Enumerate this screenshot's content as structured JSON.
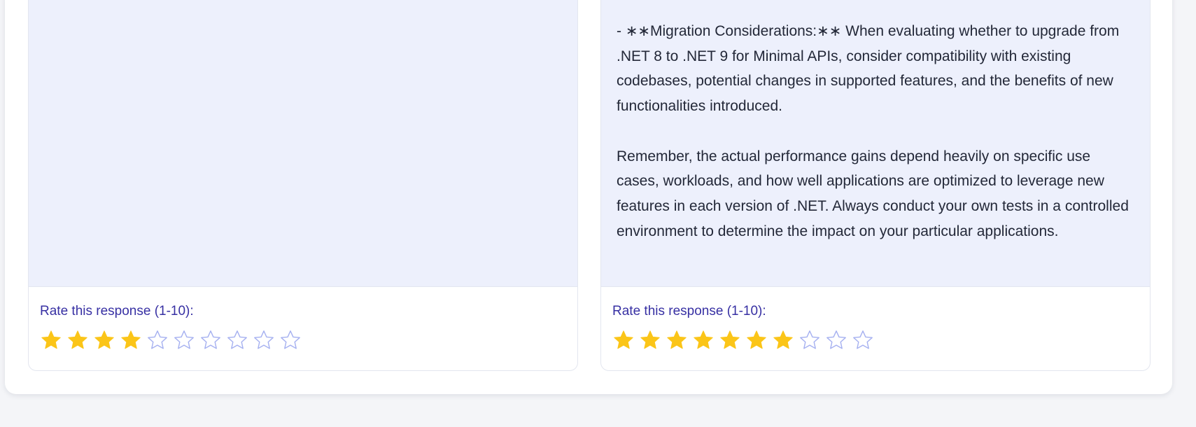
{
  "left_panel": {
    "rating_label": "Rate this response (1-10):",
    "rating": 4,
    "max_rating": 10
  },
  "right_panel": {
    "paragraphs": [
      "- ∗∗Migration Considerations:∗∗ When evaluating whether to upgrade from .NET 8 to .NET 9 for Minimal APIs, consider compatibility with existing codebases, potential changes in supported features, and the benefits of new functionalities introduced.",
      "Remember, the actual performance gains depend heavily on specific use cases, workloads, and how well applications are optimized to leverage new features in each version of .NET. Always conduct your own tests in a controlled environment to determine the impact on your particular applications."
    ],
    "rating_label": "Rate this response (1-10):",
    "rating": 7,
    "max_rating": 10
  },
  "colors": {
    "star_filled": "#fbc518",
    "star_empty_outline": "#a5b0f0",
    "label": "#3730a3",
    "content_bg": "#edf0fc"
  }
}
